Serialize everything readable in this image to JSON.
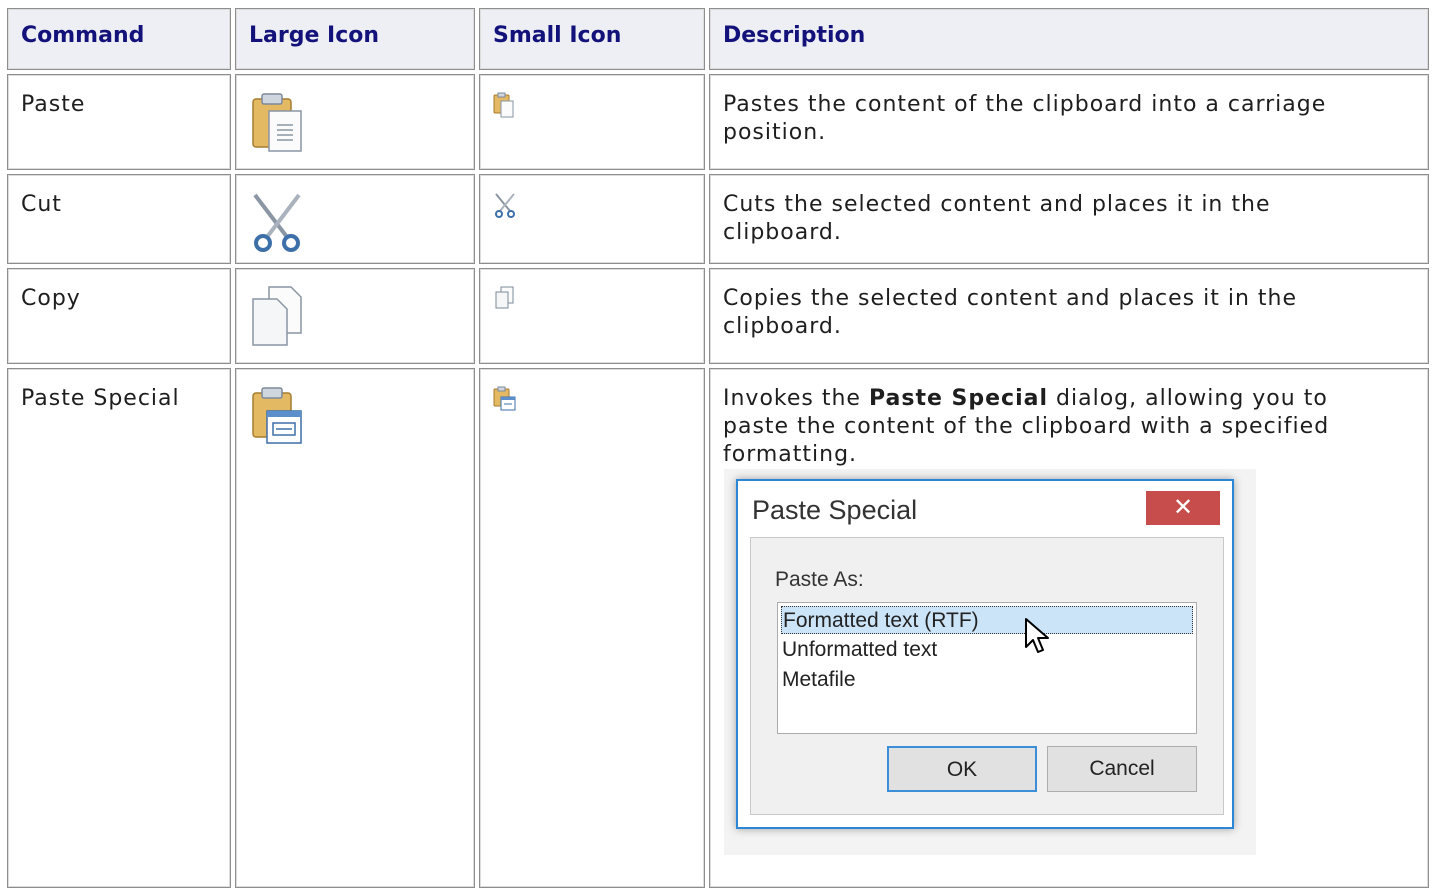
{
  "headers": [
    "Command",
    "Large Icon",
    "Small Icon",
    "Description"
  ],
  "rows": [
    {
      "command": "Paste",
      "large_icon": "paste-icon",
      "small_icon": "paste-icon",
      "description": "Pastes the content of the clipboard into a carriage position."
    },
    {
      "command": "Cut",
      "large_icon": "cut-icon",
      "small_icon": "cut-icon",
      "description": "Cuts the selected content and places it in the clipboard."
    },
    {
      "command": "Copy",
      "large_icon": "copy-icon",
      "small_icon": "copy-icon",
      "description": "Copies the selected content and places it in the clipboard."
    },
    {
      "command": "Paste Special",
      "large_icon": "paste-special-icon",
      "small_icon": "paste-special-icon",
      "description_prefix": "Invokes the ",
      "description_bold": "Paste Special",
      "description_suffix": " dialog, allowing you to paste the content of the clipboard with a specified formatting."
    }
  ],
  "dialog": {
    "title": "Paste Special",
    "close_label": "✕",
    "paste_as_label": "Paste As:",
    "options": [
      "Formatted text (RTF)",
      "Unformatted text",
      "Metafile"
    ],
    "selected_index": 0,
    "ok_label": "OK",
    "cancel_label": "Cancel"
  },
  "colors": {
    "header_bg": "#eeeff4",
    "header_text": "#12127a",
    "close_bg": "#c74d4d",
    "selection": "#cce4f7"
  }
}
